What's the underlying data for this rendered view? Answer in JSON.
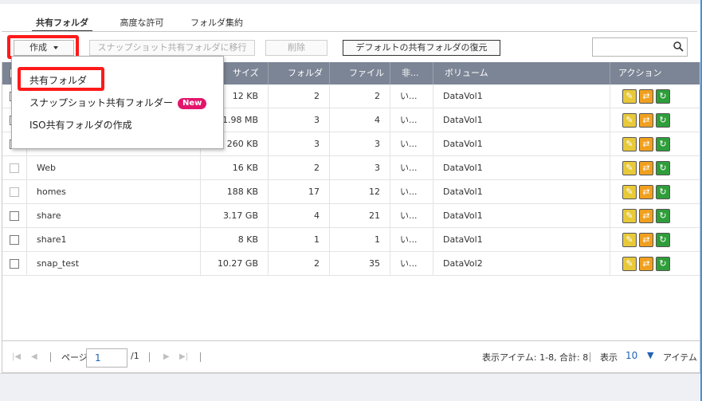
{
  "tabs": [
    {
      "label": "共有フォルダ",
      "active": true
    },
    {
      "label": "高度な許可",
      "active": false
    },
    {
      "label": "フォルダ集約",
      "active": false
    }
  ],
  "toolbar": {
    "create_label": "作成",
    "snapshot_migrate_label": "スナップショット共有フォルダに移行",
    "delete_label": "削除",
    "restore_default_label": "デフォルトの共有フォルダの復元",
    "search_value": ""
  },
  "dropdown": {
    "items": [
      {
        "label": "共有フォルダ"
      },
      {
        "label": "スナップショット共有フォルダー",
        "badge": "New"
      },
      {
        "label": "ISO共有フォルダの作成"
      }
    ]
  },
  "table": {
    "columns": [
      "サイズ",
      "フォルダ",
      "ファイル",
      "非...",
      "ボリューム",
      "アクション"
    ],
    "rows": [
      {
        "name": "",
        "size": "12 KB",
        "folders": "2",
        "files": "2",
        "hidden": "い...",
        "volume": "DataVol1"
      },
      {
        "name": "",
        "size": "1.98 MB",
        "folders": "3",
        "files": "4",
        "hidden": "い...",
        "volume": "DataVol1"
      },
      {
        "name": "",
        "size": "260 KB",
        "folders": "3",
        "files": "3",
        "hidden": "い...",
        "volume": "DataVol1"
      },
      {
        "name": "Web",
        "size": "16 KB",
        "folders": "2",
        "files": "3",
        "hidden": "い...",
        "volume": "DataVol1"
      },
      {
        "name": "homes",
        "size": "188 KB",
        "folders": "17",
        "files": "12",
        "hidden": "い...",
        "volume": "DataVol1"
      },
      {
        "name": "share",
        "size": "3.17 GB",
        "folders": "4",
        "files": "21",
        "hidden": "い...",
        "volume": "DataVol1"
      },
      {
        "name": "share1",
        "size": "8 KB",
        "folders": "1",
        "files": "1",
        "hidden": "い...",
        "volume": "DataVol1"
      },
      {
        "name": "snap_test",
        "size": "10.27 GB",
        "folders": "2",
        "files": "35",
        "hidden": "い...",
        "volume": "DataVol2"
      }
    ]
  },
  "pager": {
    "page_label": "ページ",
    "page_value": "1",
    "page_total": "/1",
    "items_info": "表示アイテム: 1-8, 合計: 8",
    "show_label": "表示",
    "per_page": "10",
    "items_label": "アイテム"
  },
  "colors": {
    "header_bg": "#7c8595",
    "highlight": "#ff1a1a",
    "new_badge": "#e2156b",
    "edit_icon": "#e8c93a",
    "refresh_icon": "#2f9e3a"
  }
}
